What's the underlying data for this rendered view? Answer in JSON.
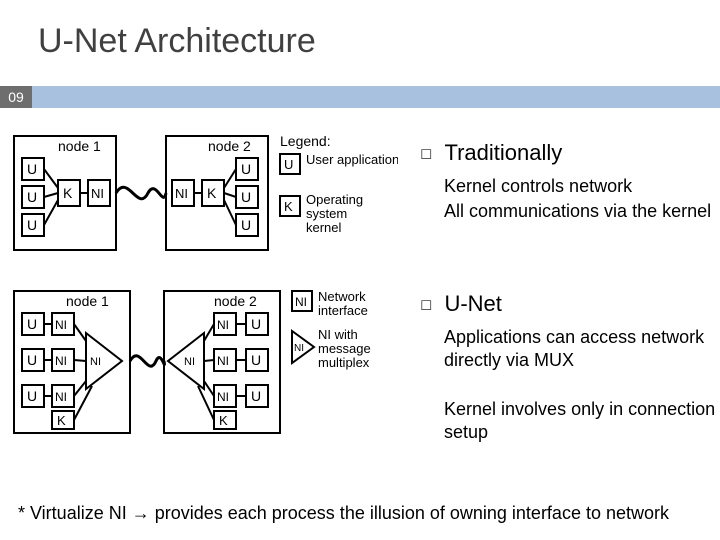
{
  "title": "U-Net Architecture",
  "page_number": "09",
  "sections": [
    {
      "heading": "Traditionally",
      "points": [
        "Kernel controls network",
        "All communications via the kernel"
      ]
    },
    {
      "heading": "U-Net",
      "points": [
        "Applications can access network directly via MUX",
        "Kernel involves only in connection setup"
      ]
    }
  ],
  "footnote": "* Virtualize NI → provides each process the illusion of owning interface to network",
  "diagram": {
    "nodes": [
      "node 1",
      "node 2"
    ],
    "box_U": "U",
    "box_K": "K",
    "box_NI": "NI",
    "legend_title": "Legend:",
    "legend": [
      {
        "sym": "U",
        "label": "User application"
      },
      {
        "sym": "K",
        "label": "Operating system kernel"
      },
      {
        "sym": "NI",
        "label": "Network interface"
      },
      {
        "sym": "NI",
        "label": "NI with message multiplex",
        "triangle": true
      }
    ]
  }
}
